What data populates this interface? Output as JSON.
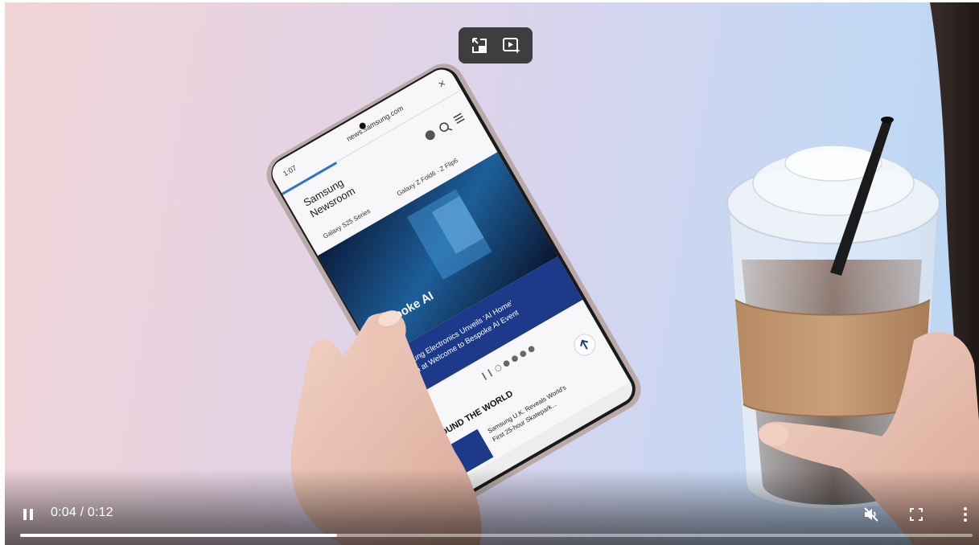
{
  "player": {
    "current_time": "0:04",
    "separator": "/",
    "duration": "0:12",
    "progress_fraction": 0.333,
    "state": "playing",
    "muted": true
  },
  "icons": {
    "pause": "pause-icon",
    "mute": "volume-muted-icon",
    "fullscreen": "fullscreen-icon",
    "more": "more-vertical-icon",
    "pip": "picture-in-picture-icon",
    "ai_video": "ai-video-icon"
  },
  "phone_screen": {
    "status_time": "1:07",
    "url": "news.samsung.com",
    "brand_line1": "Samsung",
    "brand_line2": "Newsroom",
    "nav_item1": "Galaxy S25 Series",
    "nav_item2": "Galaxy Z Fold6 · Z Flip6",
    "hero_title": "Bespoke AI",
    "banner_line1": "Samsung Electronics Unveils 'AI Home'",
    "banner_line2": "Vision at Welcome to Bespoke AI Event",
    "section_title": "ROUND THE WORLD",
    "news_line1": "Samsung U.K. Reveals World's",
    "news_line2": "First 25-hour Skatepark..."
  },
  "colors": {
    "accent": "#1428a0",
    "overlay": "#282828"
  }
}
